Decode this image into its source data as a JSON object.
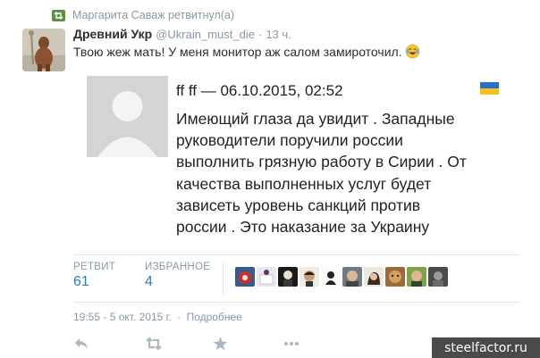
{
  "retweet": {
    "text": "Маргарита Саваж ретвитнул(а)",
    "icon": "retweet-icon",
    "color": "#5c913b"
  },
  "tweet": {
    "fullname": "Древний Укр",
    "username": "@Ukrain_must_die",
    "separator": "·",
    "time": "13 ч.",
    "text": "Твою жеж мать! У меня монитор аж салом замироточил.",
    "emoji": "face-with-tears-of-joy-icon"
  },
  "embedded": {
    "author_line": "ff ff — 06.10.2015, 02:52",
    "flag": "ukraine-flag-icon",
    "lines": [
      "Имеющий глаза да увидит . Западные",
      "руководители поручили россии",
      "выполнить грязную работу в Сирии . От",
      "качества выполненных услуг будет",
      "зависеть уровень санкций против",
      "россии . Это наказание за Украину"
    ]
  },
  "stats": {
    "retweets_label": "РЕТВИТ",
    "retweets_value": "61",
    "favorites_label": "ИЗБРАННОЕ",
    "favorites_value": "4"
  },
  "meta": {
    "datetime": "19:55 - 5 окт. 2015 г.",
    "dot": "·",
    "details": "Подробнее"
  },
  "actions": [
    "reply-icon",
    "retweet-icon",
    "favorite-icon",
    "more-icon"
  ],
  "watermark": "steelfactor.ru",
  "colors": {
    "link": "#2b7bb9",
    "muted": "#8899a6",
    "text": "#292f33"
  }
}
